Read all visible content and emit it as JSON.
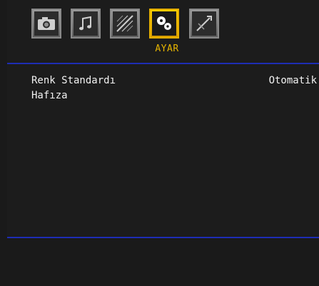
{
  "menu": {
    "icons": [
      {
        "name": "photo-icon",
        "active": false
      },
      {
        "name": "music-icon",
        "active": false
      },
      {
        "name": "video-icon",
        "active": false
      },
      {
        "name": "settings-icon",
        "active": true
      },
      {
        "name": "tools-icon",
        "active": false
      }
    ],
    "active_label": "AYAR",
    "items": [
      {
        "label": "Renk Standardı",
        "value": "Otomatik"
      },
      {
        "label": "Hafıza",
        "value": ""
      }
    ]
  },
  "colors": {
    "accent": "#e6b400",
    "rule": "#1e2db5",
    "background": "#1c1c1c",
    "text": "#f2f2f2"
  }
}
